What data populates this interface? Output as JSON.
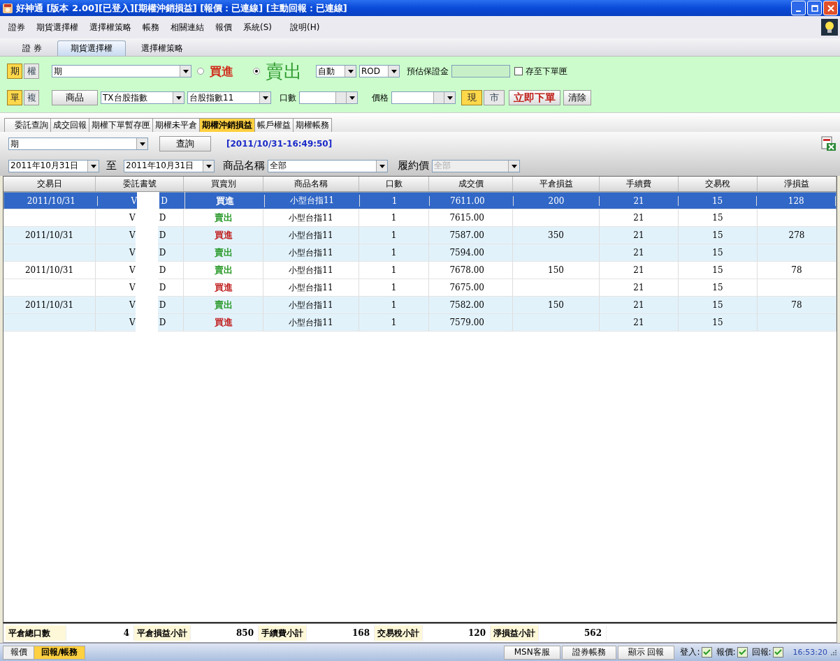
{
  "window": {
    "title": "好神通 [版本 2.00][已登入][期權沖銷損益] [報價：已連線] [主動回報：已連線]"
  },
  "menu": [
    "證券",
    "期貨選擇權",
    "選擇權策略",
    "帳務",
    "相關連結",
    "報價",
    "系統(S)",
    "說明(H)"
  ],
  "main_tabs": [
    {
      "label": "證 券",
      "selected": false
    },
    {
      "label": "期貨選擇權",
      "selected": true
    },
    {
      "label": "選擇權策略",
      "selected": false
    }
  ],
  "order_panel": {
    "type_toggle": [
      {
        "label": "期",
        "selected": true
      },
      {
        "label": "權",
        "selected": false
      }
    ],
    "contract_select": "期",
    "sides": [
      {
        "label": "買進",
        "selected": false,
        "kind": "buy"
      },
      {
        "label": "賣出",
        "selected": true,
        "kind": "sell"
      }
    ],
    "price_mode": "自動",
    "time_in_force": "ROD",
    "margin_label": "預估保證金",
    "save_checkbox": {
      "label": "存至下單匣",
      "checked": false
    },
    "mode_toggle": [
      {
        "label": "單",
        "selected": true
      },
      {
        "label": "複",
        "selected": false
      }
    ],
    "product_button": "商品",
    "product_select": "TX台股指數",
    "month_select": "台股指數11",
    "qty_label": "口數",
    "price_label": "價格",
    "price_type": [
      {
        "label": "現",
        "selected": true
      },
      {
        "label": "市",
        "selected": false
      }
    ],
    "submit_button": "立即下單",
    "clear_button": "清除"
  },
  "sub_tabs": [
    {
      "label": "委託查詢",
      "selected": false
    },
    {
      "label": "成交回報",
      "selected": false
    },
    {
      "label": "期權下單暫存匣",
      "selected": false
    },
    {
      "label": "期權未平倉",
      "selected": false
    },
    {
      "label": "期權沖銷損益",
      "selected": true
    },
    {
      "label": "帳戶權益",
      "selected": false
    },
    {
      "label": "期權帳務",
      "selected": false
    }
  ],
  "query": {
    "type_select": "期",
    "query_button": "查詢",
    "timestamp": "[2011/10/31-16:49:50]",
    "date_from": "2011年10月31日",
    "to_label": "至",
    "date_to": "2011年10月31日",
    "product_label": "商品名稱",
    "product_select": "全部",
    "strike_label": "履約價",
    "strike_select": "全部"
  },
  "table": {
    "columns": [
      "交易日",
      "委託書號",
      "買賣別",
      "商品名稱",
      "口數",
      "成交價",
      "平倉損益",
      "手續費",
      "交易稅",
      "淨損益"
    ],
    "rows": [
      {
        "selected": true,
        "shaded": false,
        "date": "2011/10/31",
        "order_prefix": "V",
        "order_suffix": "D",
        "side": "買進",
        "product": "小型台指11",
        "qty": "1",
        "price": "7611.00",
        "pnl": "200",
        "fee": "21",
        "tax": "15",
        "net": "128"
      },
      {
        "selected": false,
        "shaded": false,
        "date": "",
        "order_prefix": "V",
        "order_suffix": "D",
        "side": "賣出",
        "color": "#2a9a2a",
        "product": "小型台指11",
        "qty": "1",
        "price": "7615.00",
        "pnl": "",
        "fee": "21",
        "tax": "15",
        "net": ""
      },
      {
        "selected": false,
        "shaded": true,
        "date": "2011/10/31",
        "order_prefix": "V",
        "order_suffix": "D",
        "side": "買進",
        "color": "#c02020",
        "product": "小型台指11",
        "qty": "1",
        "price": "7587.00",
        "pnl": "350",
        "fee": "21",
        "tax": "15",
        "net": "278"
      },
      {
        "selected": false,
        "shaded": true,
        "date": "",
        "order_prefix": "V",
        "order_suffix": "D",
        "side": "賣出",
        "color": "#2a9a2a",
        "product": "小型台指11",
        "qty": "1",
        "price": "7594.00",
        "pnl": "",
        "fee": "21",
        "tax": "15",
        "net": ""
      },
      {
        "selected": false,
        "shaded": false,
        "date": "2011/10/31",
        "order_prefix": "V",
        "order_suffix": "D",
        "side": "賣出",
        "color": "#2a9a2a",
        "product": "小型台指11",
        "qty": "1",
        "price": "7678.00",
        "pnl": "150",
        "fee": "21",
        "tax": "15",
        "net": "78"
      },
      {
        "selected": false,
        "shaded": false,
        "date": "",
        "order_prefix": "V",
        "order_suffix": "D",
        "side": "買進",
        "color": "#c02020",
        "product": "小型台指11",
        "qty": "1",
        "price": "7675.00",
        "pnl": "",
        "fee": "21",
        "tax": "15",
        "net": ""
      },
      {
        "selected": false,
        "shaded": true,
        "date": "2011/10/31",
        "order_prefix": "V",
        "order_suffix": "D",
        "side": "賣出",
        "color": "#2a9a2a",
        "product": "小型台指11",
        "qty": "1",
        "price": "7582.00",
        "pnl": "150",
        "fee": "21",
        "tax": "15",
        "net": "78"
      },
      {
        "selected": false,
        "shaded": true,
        "date": "",
        "order_prefix": "V",
        "order_suffix": "D",
        "side": "買進",
        "color": "#c02020",
        "product": "小型台指11",
        "qty": "1",
        "price": "7579.00",
        "pnl": "",
        "fee": "21",
        "tax": "15",
        "net": ""
      }
    ]
  },
  "summary": [
    {
      "label": "平倉總口數",
      "value": "4"
    },
    {
      "label": "平倉損益小計",
      "value": "850"
    },
    {
      "label": "手續費小計",
      "value": "168"
    },
    {
      "label": "交易稅小計",
      "value": "120"
    },
    {
      "label": "淨損益小計",
      "value": "562"
    }
  ],
  "status_bar": {
    "tabs": [
      {
        "label": "報價",
        "selected": false
      },
      {
        "label": "回報/帳務",
        "selected": true
      }
    ],
    "buttons": [
      "MSN客服",
      "證券帳務",
      "顯示 回報"
    ],
    "indicators": [
      {
        "label": "登入:",
        "checked": true
      },
      {
        "label": "報價:",
        "checked": true
      },
      {
        "label": "回報:",
        "checked": true
      }
    ],
    "time": "16:53:20"
  }
}
